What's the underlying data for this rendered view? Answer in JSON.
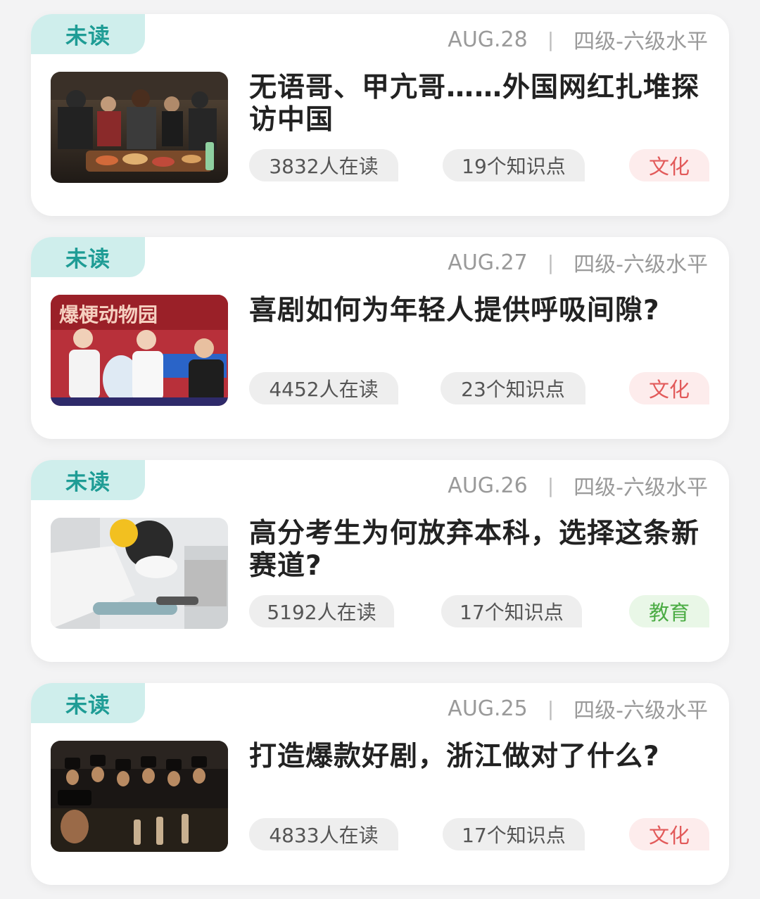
{
  "articles": [
    {
      "status": "未读",
      "date": "AUG.28",
      "separator": "|",
      "level": "四级-六级水平",
      "title": "无语哥、甲亢哥……外国网红扎堆探访中国",
      "readers": "3832人在读",
      "points": "19个知识点",
      "tag": "文化",
      "tag_color": "#e25a5a",
      "image": "crowd-eating-street-food-photo"
    },
    {
      "status": "未读",
      "date": "AUG.27",
      "separator": "|",
      "level": "四级-六级水平",
      "title": "喜剧如何为年轻人提供呼吸间隙?",
      "readers": "4452人在读",
      "points": "23个知识点",
      "tag": "文化",
      "tag_color": "#e25a5a",
      "image": "comedy-show-stage-photo",
      "image_sign_text": "爆梗动物园"
    },
    {
      "status": "未读",
      "date": "AUG.26",
      "separator": "|",
      "level": "四级-六级水平",
      "title": "高分考生为何放弃本科，选择这条新赛道?",
      "readers": "5192人在读",
      "points": "17个知识点",
      "tag": "教育",
      "tag_color": "#4bac44",
      "image": "student-carving-stone-photo"
    },
    {
      "status": "未读",
      "date": "AUG.25",
      "separator": "|",
      "level": "四级-六级水平",
      "title": "打造爆款好剧，浙江做对了什么?",
      "readers": "4833人在读",
      "points": "17个知识点",
      "tag": "文化",
      "tag_color": "#e25a5a",
      "image": "historical-drama-still-photo"
    }
  ]
}
